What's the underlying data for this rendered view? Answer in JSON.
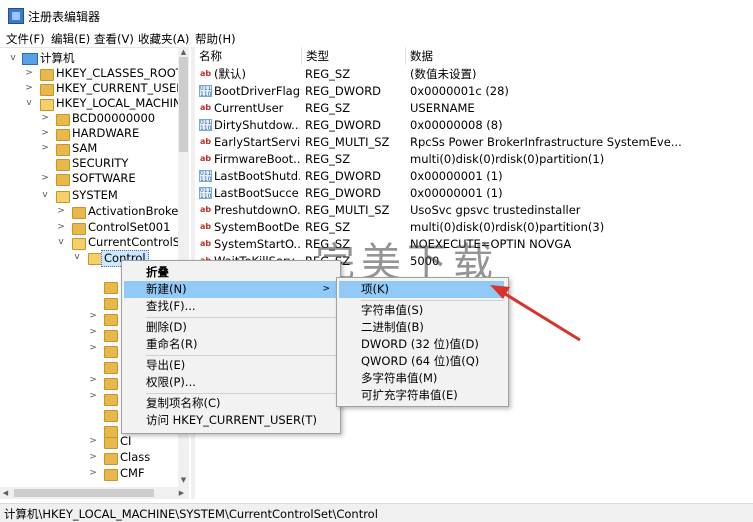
{
  "window": {
    "title": "注册表编辑器"
  },
  "menubar": [
    "文件(F)",
    "编辑(E)",
    "查看(V)",
    "收藏夹(A)",
    "帮助(H)"
  ],
  "tree": {
    "computer": "计算机",
    "items": [
      "HKEY_CLASSES_ROOT",
      "HKEY_CURRENT_USER",
      "HKEY_LOCAL_MACHINE",
      "BCD00000000",
      "HARDWARE",
      "SAM",
      "SECURITY",
      "SOFTWARE",
      "SYSTEM",
      "ActivationBroker",
      "ControlSet001",
      "CurrentControlSet",
      "Control",
      "CI",
      "Class",
      "CMF"
    ],
    "selected": "Control"
  },
  "columns": {
    "name": "名称",
    "type": "类型",
    "data": "数据"
  },
  "values": [
    {
      "name": "(默认)",
      "type": "REG_SZ",
      "data": "(数值未设置)",
      "icon": "string-value-icon"
    },
    {
      "name": "BootDriverFlags",
      "type": "REG_DWORD",
      "data": "0x0000001c (28)",
      "icon": "binary-value-icon"
    },
    {
      "name": "CurrentUser",
      "type": "REG_SZ",
      "data": "USERNAME",
      "icon": "string-value-icon"
    },
    {
      "name": "DirtyShutdow...",
      "type": "REG_DWORD",
      "data": "0x00000008 (8)",
      "icon": "binary-value-icon"
    },
    {
      "name": "EarlyStartServi...",
      "type": "REG_MULTI_SZ",
      "data": "RpcSs Power BrokerInfrastructure SystemEve...",
      "icon": "string-value-icon"
    },
    {
      "name": "FirmwareBoot...",
      "type": "REG_SZ",
      "data": "multi(0)disk(0)rdisk(0)partition(1)",
      "icon": "string-value-icon"
    },
    {
      "name": "LastBootShutd...",
      "type": "REG_DWORD",
      "data": "0x00000001 (1)",
      "icon": "binary-value-icon"
    },
    {
      "name": "LastBootSucce...",
      "type": "REG_DWORD",
      "data": "0x00000001 (1)",
      "icon": "binary-value-icon"
    },
    {
      "name": "PreshutdownO...",
      "type": "REG_MULTI_SZ",
      "data": "UsoSvc gpsvc trustedinstaller",
      "icon": "string-value-icon"
    },
    {
      "name": "SystemBootDe...",
      "type": "REG_SZ",
      "data": "multi(0)disk(0)rdisk(0)partition(3)",
      "icon": "string-value-icon"
    },
    {
      "name": "SystemStartO...",
      "type": "REG_SZ",
      "data": "NOEXECUTE=OPTIN  NOVGA",
      "icon": "string-value-icon"
    },
    {
      "name": "WaitToKillServ...",
      "type": "REG_SZ",
      "data": "5000",
      "icon": "string-value-icon"
    }
  ],
  "context_menu": {
    "collapse": "折叠",
    "new": "新建(N)",
    "find": "查找(F)...",
    "delete": "删除(D)",
    "rename": "重命名(R)",
    "export": "导出(E)",
    "permissions": "权限(P)...",
    "copy_key_name": "复制项名称(C)",
    "goto_hkcu": "访问 HKEY_CURRENT_USER(T)"
  },
  "submenu": {
    "key": "项(K)",
    "string": "字符串值(S)",
    "binary": "二进制值(B)",
    "dword": "DWORD (32 位)值(D)",
    "qword": "QWORD (64 位)值(Q)",
    "multi_string": "多字符串值(M)",
    "expandable_string": "可扩充字符串值(E)"
  },
  "watermark": "完美下载",
  "statusbar": {
    "path": "计算机\\HKEY_LOCAL_MACHINE\\SYSTEM\\CurrentControlSet\\Control"
  },
  "annotation": {
    "arrow_color": "#d9342b"
  },
  "colors": {
    "menu_highlight": "#91c9f7",
    "selection": "#cce8ff",
    "folder": "#e9b84a"
  }
}
